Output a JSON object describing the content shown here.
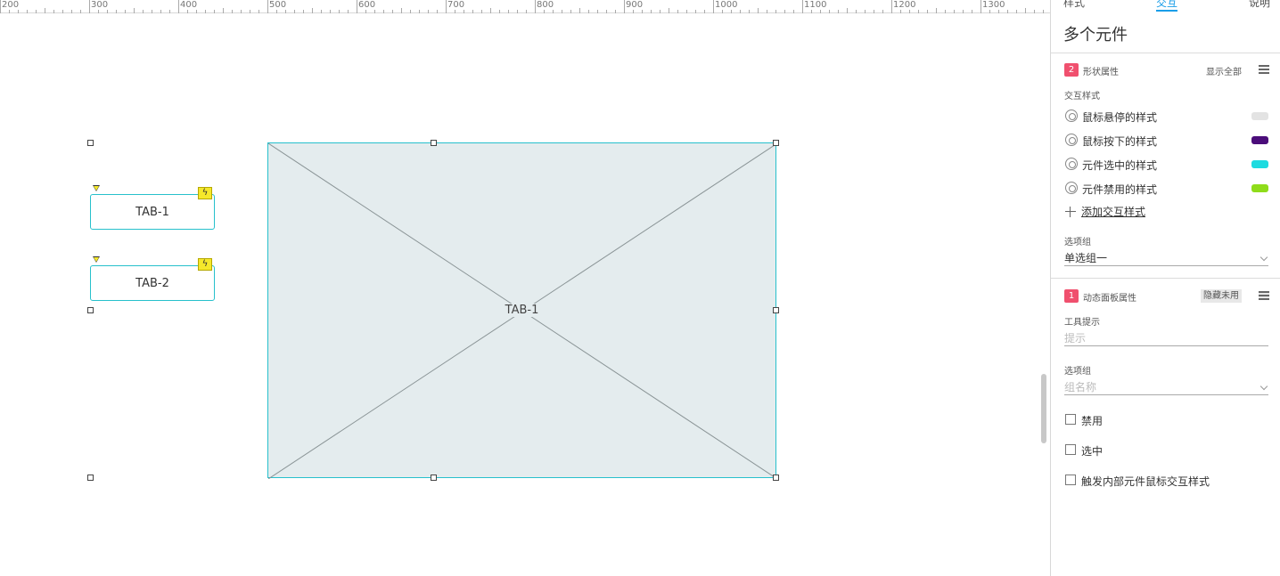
{
  "ruler": {
    "labels": [
      "200",
      "300",
      "400",
      "500",
      "600",
      "700",
      "800",
      "900",
      "1000",
      "1100",
      "1200",
      "1300"
    ]
  },
  "canvas": {
    "buttons": [
      {
        "label": "TAB-1"
      },
      {
        "label": "TAB-2"
      }
    ],
    "panel_label": "TAB-1"
  },
  "inspector": {
    "tabs": [
      "样式",
      "交互",
      "说明"
    ],
    "title": "多个元件",
    "shape_section": {
      "badge": "2",
      "title": "形状属性",
      "show_all": "显示全部"
    },
    "interaction_styles_label": "交互样式",
    "interaction_styles": [
      {
        "label": "鼠标悬停的样式",
        "color": "#e3e3e3"
      },
      {
        "label": "鼠标按下的样式",
        "color": "#4b0d7a"
      },
      {
        "label": "元件选中的样式",
        "color": "#1ddbe0"
      },
      {
        "label": "元件禁用的样式",
        "color": "#8fdc1a"
      }
    ],
    "add_style": "添加交互样式",
    "option_group_label": "选项组",
    "option_group_value": "单选组一",
    "panel_section": {
      "badge": "1",
      "title": "动态面板属性",
      "hide_unused": "隐藏未用"
    },
    "tooltip_label": "工具提示",
    "tooltip_placeholder": "提示",
    "group_label": "选项组",
    "group_placeholder": "组名称",
    "checkboxes": [
      {
        "label": "禁用"
      },
      {
        "label": "选中"
      },
      {
        "label": "触发内部元件鼠标交互样式"
      }
    ]
  }
}
